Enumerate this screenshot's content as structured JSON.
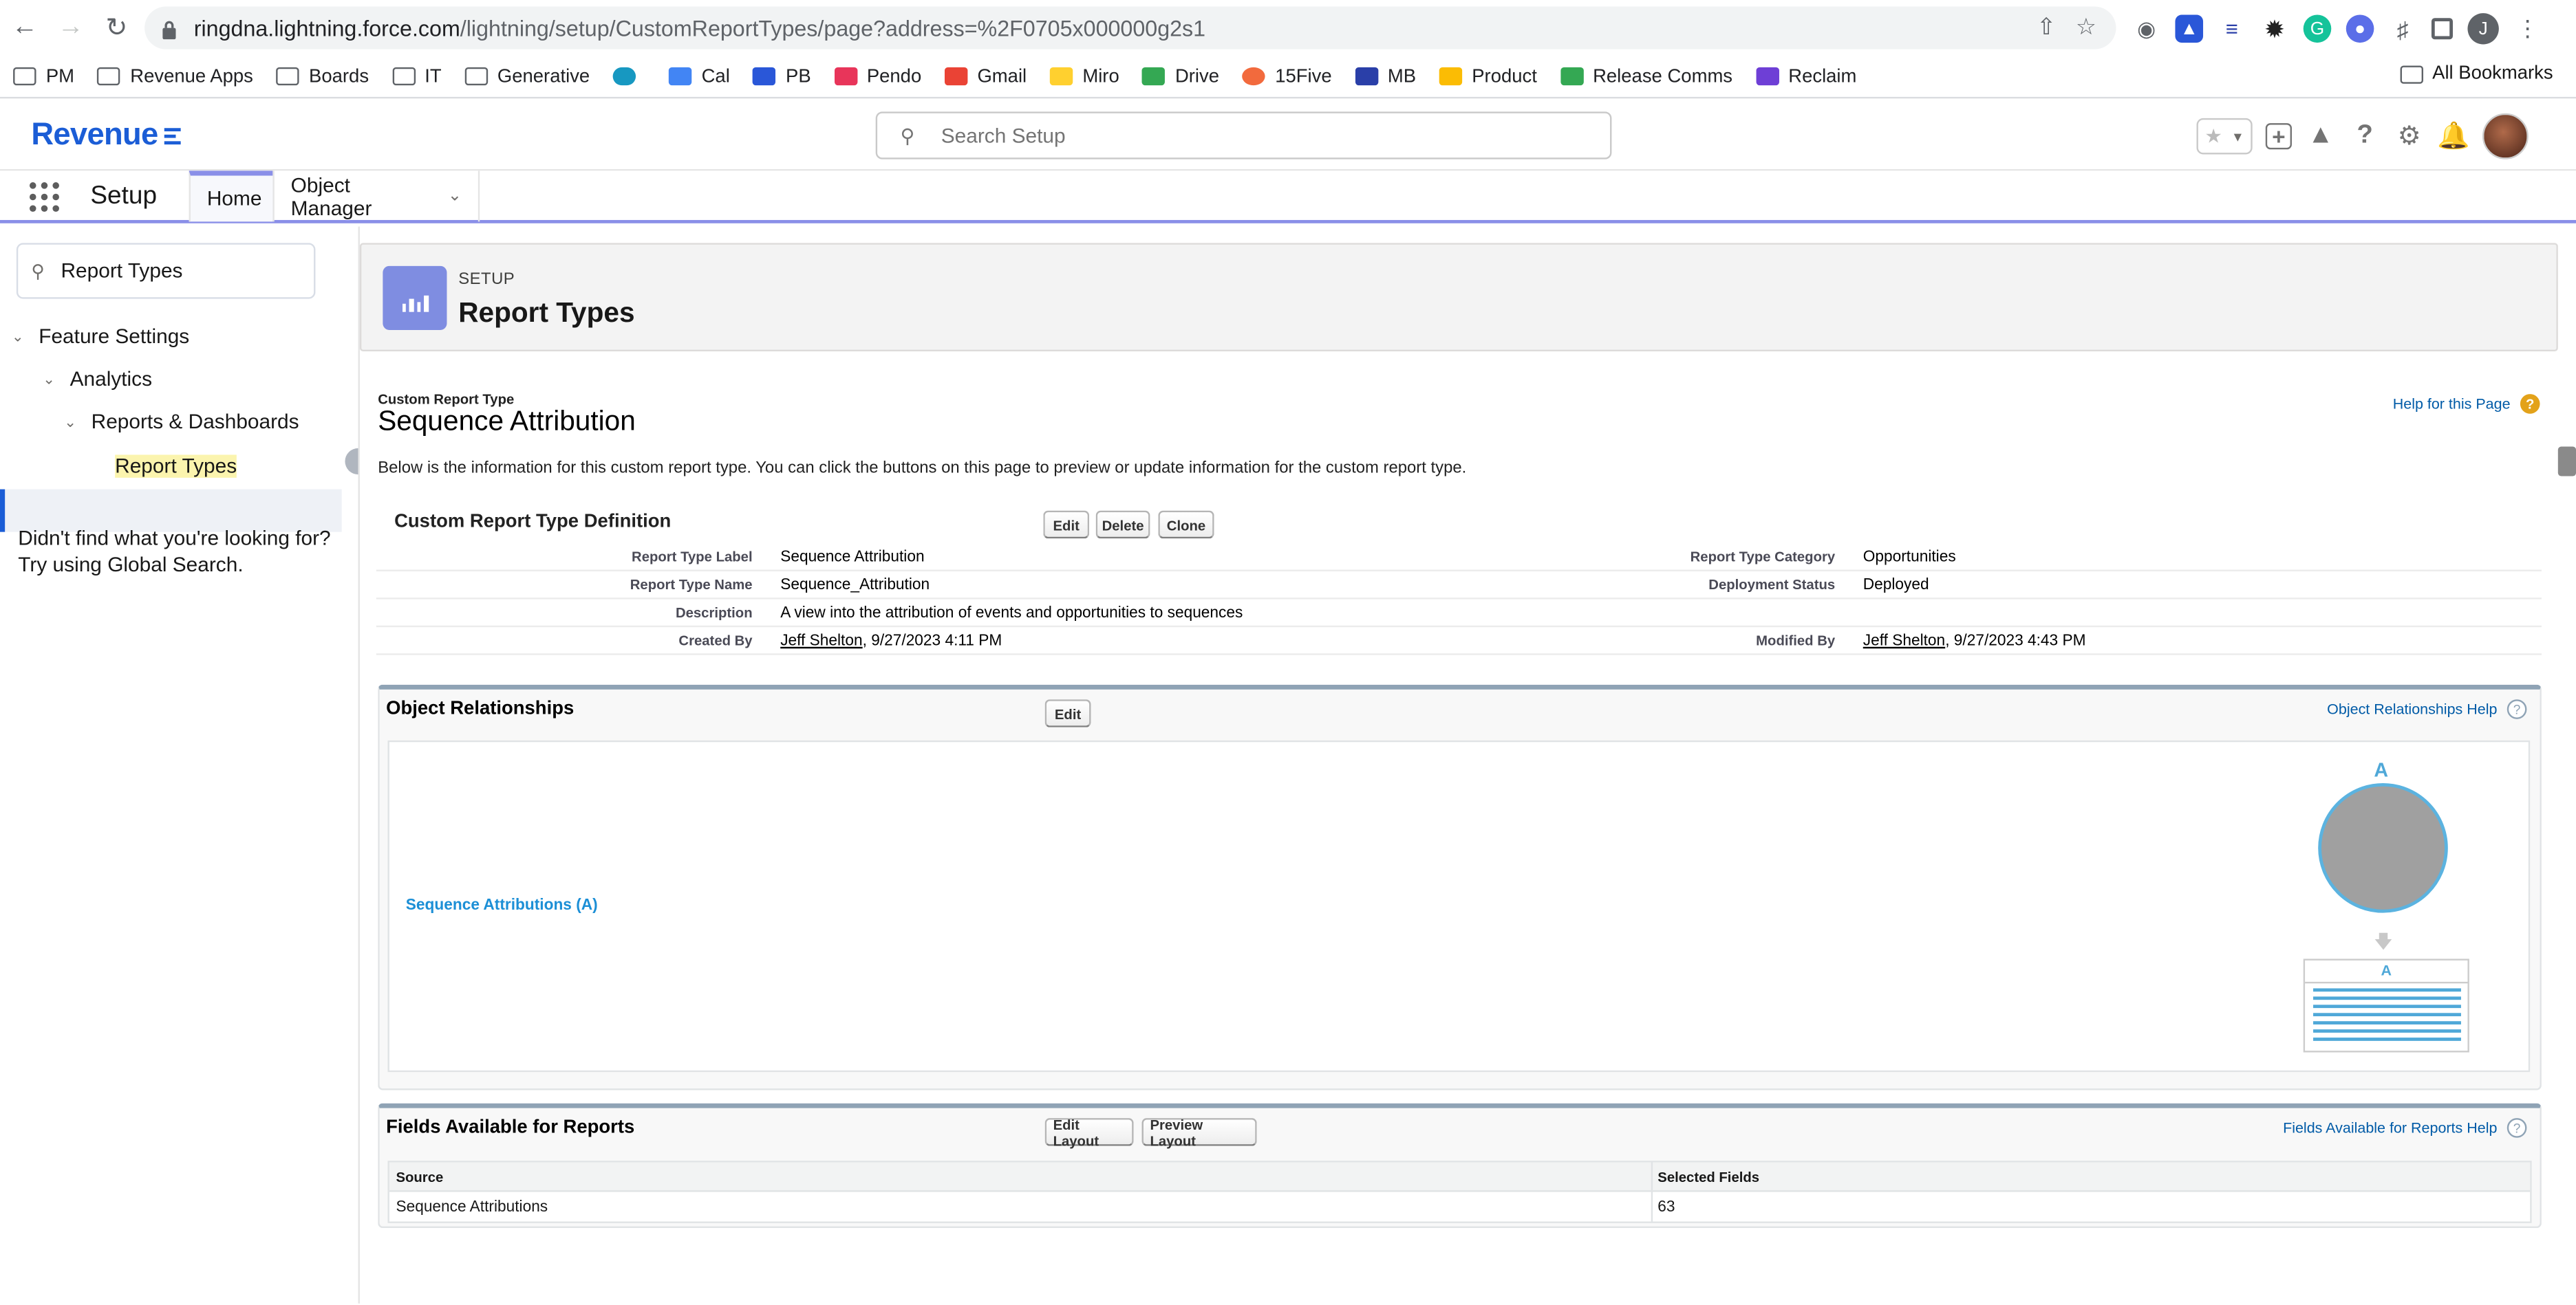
{
  "browser": {
    "url_host": "ringdna.lightning.force.com",
    "url_path": "/lightning/setup/CustomReportTypes/page?address=%2F0705x000000g2s1",
    "profile_initial": "J",
    "bookmarks": [
      {
        "label": "PM",
        "icon": "folder-icon"
      },
      {
        "label": "Revenue Apps",
        "icon": "folder-icon"
      },
      {
        "label": "Boards",
        "icon": "folder-icon"
      },
      {
        "label": "IT",
        "icon": "folder-icon"
      },
      {
        "label": "Generative",
        "icon": "folder-icon"
      },
      {
        "label": "",
        "icon": "salesforce-icon"
      },
      {
        "label": "Cal",
        "icon": "calendar-icon"
      },
      {
        "label": "PB",
        "icon": "pb-icon"
      },
      {
        "label": "Pendo",
        "icon": "pendo-icon"
      },
      {
        "label": "Gmail",
        "icon": "gmail-icon"
      },
      {
        "label": "Miro",
        "icon": "miro-icon"
      },
      {
        "label": "Drive",
        "icon": "drive-icon"
      },
      {
        "label": "15Five",
        "icon": "15five-icon"
      },
      {
        "label": "MB",
        "icon": "mb-icon"
      },
      {
        "label": "Product",
        "icon": "drive-icon"
      },
      {
        "label": "Release Comms",
        "icon": "drive-icon"
      },
      {
        "label": "Reclaim",
        "icon": "reclaim-icon"
      }
    ],
    "all_bookmarks": "All Bookmarks"
  },
  "header": {
    "logo_text": "Revenue",
    "search_placeholder": "Search Setup"
  },
  "nav": {
    "app_name": "Setup",
    "tabs": [
      {
        "label": "Home"
      },
      {
        "label": "Object Manager"
      }
    ]
  },
  "sidebar": {
    "quickfind_value": "Report Types",
    "tree": [
      {
        "label": "Feature Settings"
      },
      {
        "label": "Analytics"
      },
      {
        "label": "Reports & Dashboards"
      },
      {
        "label": "Report Types"
      }
    ],
    "not_found_line1": "Didn't find what you're looking for?",
    "not_found_line2": "Try using Global Search."
  },
  "banner": {
    "subtitle": "SETUP",
    "title": "Report Types"
  },
  "page": {
    "entity_label": "Custom Report Type",
    "title": "Sequence Attribution",
    "help_link": "Help for this Page",
    "intro": "Below is the information for this custom report type. You can click the buttons on this page to preview or update information for the custom report type.",
    "definition": {
      "heading": "Custom Report Type Definition",
      "buttons": [
        "Edit",
        "Delete",
        "Clone"
      ],
      "rows": [
        {
          "label1": "Report Type Label",
          "value1": "Sequence Attribution",
          "label2": "Report Type Category",
          "value2": "Opportunities"
        },
        {
          "label1": "Report Type Name",
          "value1": "Sequence_Attribution",
          "label2": "Deployment Status",
          "value2": "Deployed"
        },
        {
          "label1": "Description",
          "value1": "A view into the attribution of events and opportunities to sequences",
          "label2": "",
          "value2": ""
        }
      ],
      "created_by_label": "Created By",
      "created_by_name": "Jeff Shelton",
      "created_by_date": ", 9/27/2023 4:11 PM",
      "modified_by_label": "Modified By",
      "modified_by_name": "Jeff Shelton",
      "modified_by_date": ", 9/27/2023 4:43 PM"
    },
    "relationships": {
      "heading": "Object Relationships",
      "edit_button": "Edit",
      "help_link": "Object Relationships Help",
      "object_link": "Sequence Attributions (A)",
      "object_letter": "A",
      "table_letter": "A"
    },
    "fields": {
      "heading": "Fields Available for Reports",
      "buttons": [
        "Edit Layout",
        "Preview Layout"
      ],
      "help_link": "Fields Available for Reports Help",
      "columns": [
        "Source",
        "Selected Fields"
      ],
      "rows": [
        {
          "source": "Sequence Attributions",
          "count": "63"
        }
      ]
    }
  }
}
